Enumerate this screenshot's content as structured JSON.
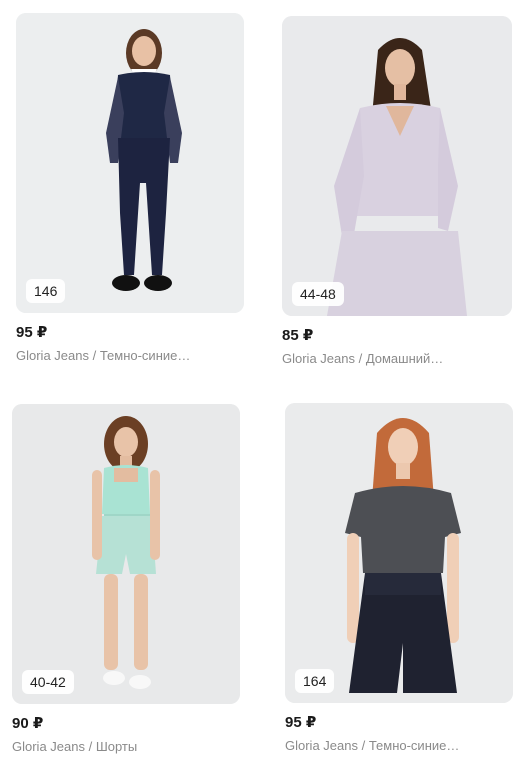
{
  "products": [
    {
      "size": "146",
      "price": "95 ₽",
      "title": "Gloria Jeans / Темно-синие…",
      "colors": {
        "top": "#1f2845",
        "pants": "#1d2340",
        "bg": "#eceeef"
      }
    },
    {
      "size": "44-48",
      "price": "85 ₽",
      "title": "Gloria Jeans / Домашний…",
      "colors": {
        "top": "#d9d1e0",
        "pants": "#d8d1df",
        "bg": "#e9eaec"
      }
    },
    {
      "size": "40-42",
      "price": "90 ₽",
      "title": "Gloria Jeans / Шорты",
      "colors": {
        "top": "#a9e3d3",
        "pants": "#b6e1d5",
        "bg": "#e8e9ea"
      }
    },
    {
      "size": "164",
      "price": "95 ₽",
      "title": "Gloria Jeans / Темно-синие…",
      "colors": {
        "top": "#4d4f54",
        "pants": "#1f2230",
        "bg": "#eaebec"
      }
    }
  ]
}
